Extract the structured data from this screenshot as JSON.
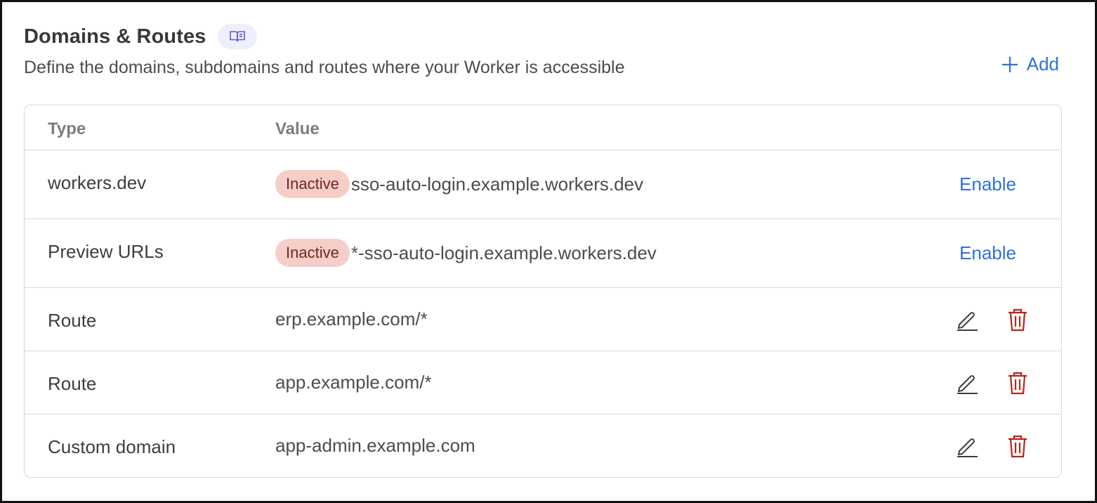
{
  "header": {
    "title": "Domains & Routes",
    "subtitle": "Define the domains, subdomains and routes where your Worker is accessible",
    "add_label": "Add",
    "docs_icon": "book-icon"
  },
  "table": {
    "columns": [
      "Type",
      "Value"
    ],
    "rows": [
      {
        "type": "workers.dev",
        "badge": "Inactive",
        "value": "sso-auto-login.example.workers.dev",
        "action": "Enable"
      },
      {
        "type": "Preview URLs",
        "badge": "Inactive",
        "value": "*-sso-auto-login.example.workers.dev",
        "action": "Enable"
      },
      {
        "type": "Route",
        "value": "erp.example.com/*"
      },
      {
        "type": "Route",
        "value": "app.example.com/*"
      },
      {
        "type": "Custom domain",
        "value": "app-admin.example.com"
      }
    ]
  },
  "colors": {
    "accent": "#2f6fe0",
    "danger": "#b3261e",
    "badge_bg": "#f5cdc9",
    "docs_bg": "#efeefb"
  }
}
